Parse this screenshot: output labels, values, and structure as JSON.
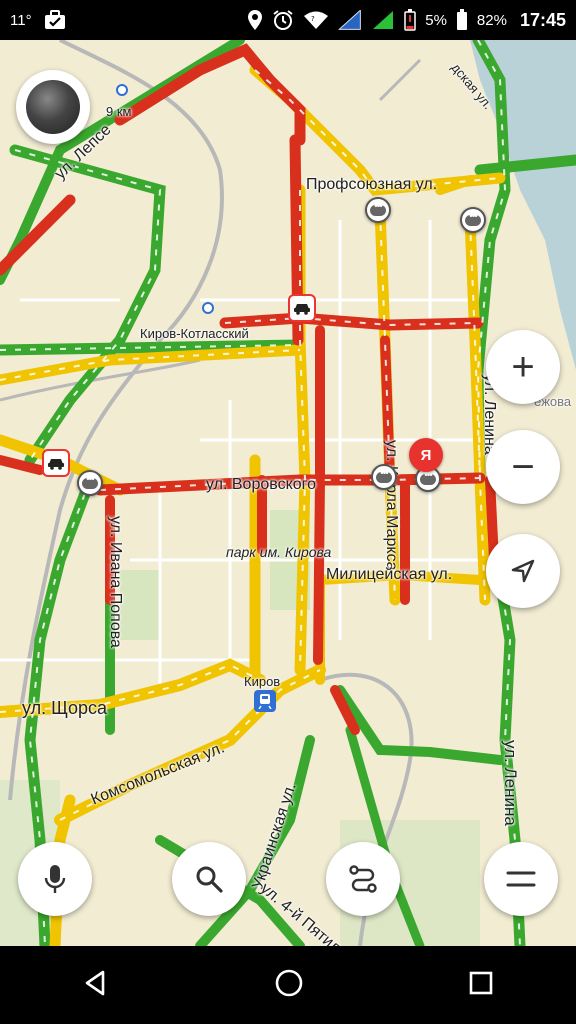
{
  "status_bar": {
    "temperature": "11°",
    "battery_saver": "5%",
    "battery": "82%",
    "time": "17:45",
    "icons": [
      "temperature-icon",
      "briefcase-check-icon",
      "location-icon",
      "alarm-icon",
      "wifi-icon",
      "signal-icon",
      "battery-low-icon",
      "battery-icon"
    ]
  },
  "map": {
    "labels": {
      "street_lepse": "ул. Лепсе",
      "street_profsoyuznaya": "Профсоюзная ул.",
      "station_kirov_kotlassky": "Киров-Котласский",
      "street_karla_marksa": "ул. Карла Маркса",
      "street_lenina_1": "ул. Ленина",
      "street_vorovskogo": "ул. Воровского",
      "street_ivana_popova": "ул. Ивана Попова",
      "park_kirova": "парк им. Кирова",
      "street_militseyskaya": "Милицейская ул.",
      "station_kirov": "Киров",
      "street_shchorsa": "ул. Щорса",
      "street_komsomolskaya": "Комсомольская ул.",
      "street_ukrainskaya": "Украинская ул.",
      "street_lenina_2": "ул. Ленина",
      "street_pyatiletki": "ул. 4-й Пятилет",
      "street_partial_top": "дская ул.",
      "distance_9km": "9 км",
      "area_partial": "ёжова"
    },
    "my_location_marker": "Я",
    "traffic_colors": {
      "free": "#3aa82e",
      "moderate": "#f0c400",
      "heavy": "#d8301c",
      "jam": "#a52418",
      "water": "#b9d2d8",
      "park": "#cfe3b3",
      "land": "#f2ecd3",
      "rail": "#b5b5b5"
    }
  },
  "controls": {
    "zoom_in": "+",
    "zoom_out": "−"
  }
}
